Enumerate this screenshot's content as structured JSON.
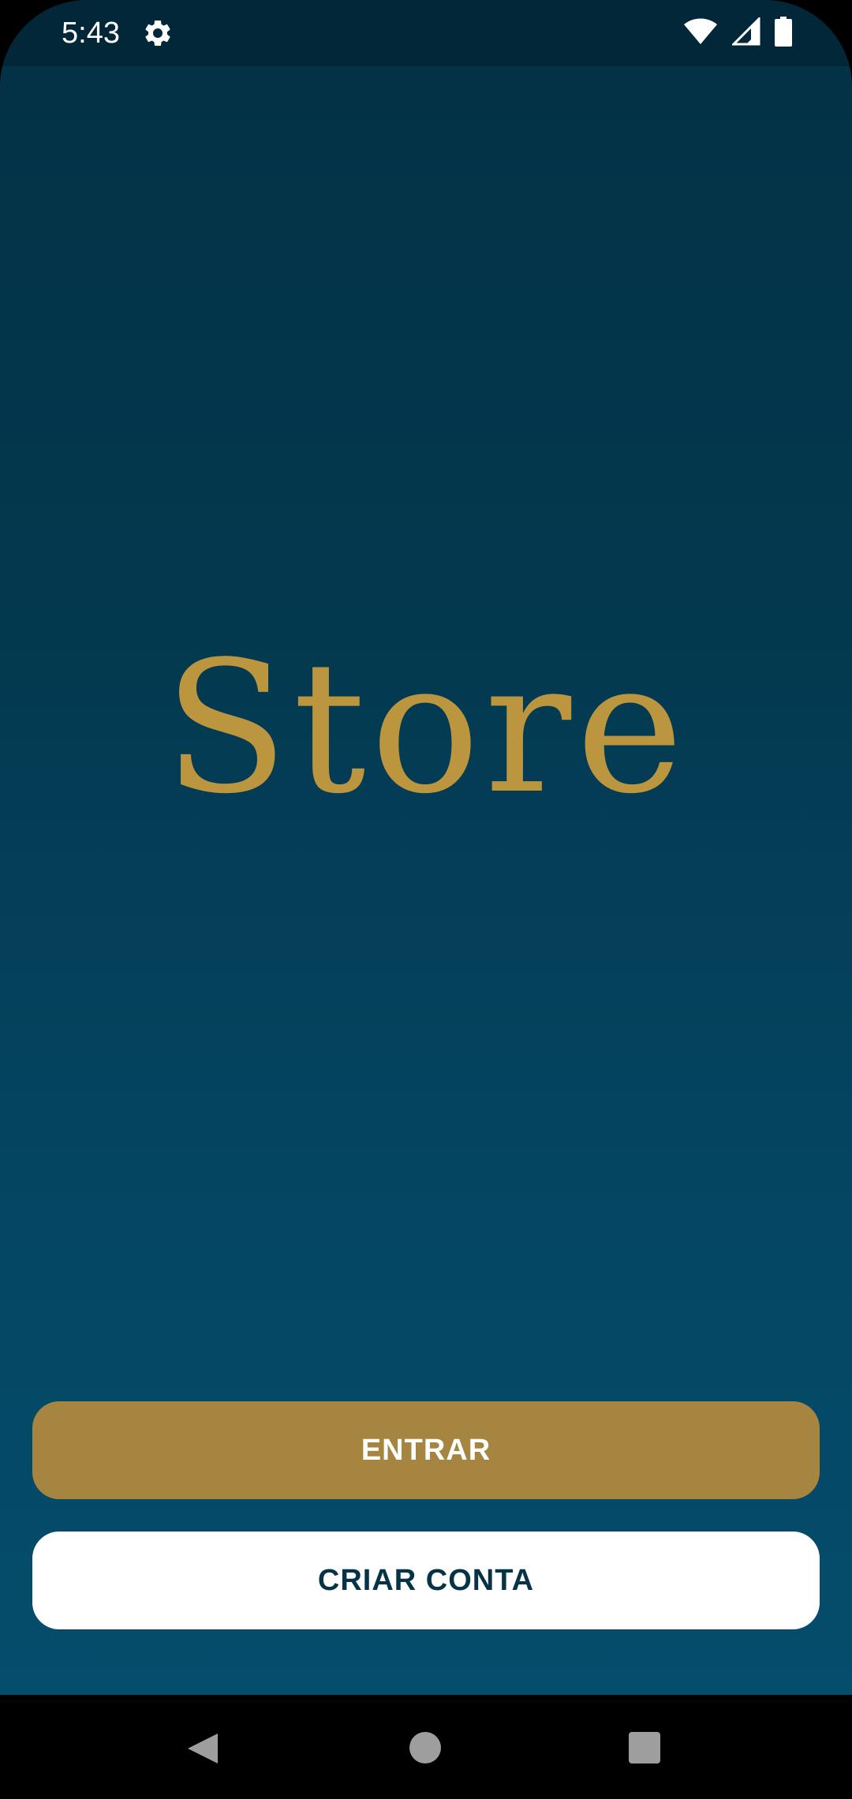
{
  "status_bar": {
    "time": "5:43",
    "icons": [
      "gear-icon",
      "wifi-icon",
      "signal-icon",
      "battery-icon"
    ]
  },
  "brand": {
    "name": "Store",
    "color": "#bc963f"
  },
  "buttons": {
    "login_label": "ENTRAR",
    "signup_label": "CRIAR CONTA"
  },
  "colors": {
    "background_top": "#033246",
    "background_bottom": "#054d6c",
    "primary_button": "#a68540",
    "secondary_button": "#ffffff",
    "secondary_text": "#073347"
  },
  "nav_bar": {
    "icons": [
      "back-icon",
      "home-icon",
      "recents-icon"
    ]
  }
}
